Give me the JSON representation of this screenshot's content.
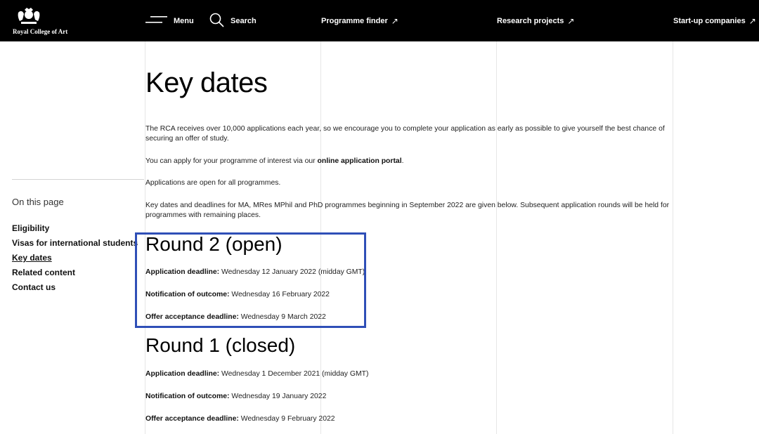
{
  "header": {
    "logo_text": "Royal College of Art",
    "menu_label": "Menu",
    "search_label": "Search",
    "programme_finder": "Programme finder",
    "research_projects": "Research projects",
    "startups": "Start-up companies",
    "external_arrow": "↗"
  },
  "sidebar": {
    "heading": "On this page",
    "items": [
      {
        "label": "Eligibility"
      },
      {
        "label": "Visas for international students"
      },
      {
        "label": "Key dates"
      },
      {
        "label": "Related content"
      },
      {
        "label": "Contact us"
      }
    ]
  },
  "main": {
    "title": "Key dates",
    "intro": "The RCA receives over 10,000 applications each year, so we encourage you to complete your application as early as possible to give yourself the best chance of securing an offer of study.",
    "apply_prefix": "You can apply for your programme of interest via our ",
    "apply_link": "online application portal",
    "apply_suffix": ".",
    "open_note": "Applications are open for all programmes.",
    "deadlines_note": "Key dates and deadlines for MA, MRes MPhil and PhD programmes beginning in September 2022 are given below. Subsequent application rounds will be held for programmes with remaining places.",
    "rounds": [
      {
        "title": "Round 2 (open)",
        "rows": [
          {
            "label": "Application deadline:",
            "value": " Wednesday 12 January 2022 (midday GMT)"
          },
          {
            "label": "Notification of outcome:",
            "value": " Wednesday 16 February 2022"
          },
          {
            "label": "Offer acceptance deadline:",
            "value": " Wednesday 9 March 2022"
          }
        ]
      },
      {
        "title": "Round 1 (closed)",
        "rows": [
          {
            "label": "Application deadline:",
            "value": " Wednesday 1 December 2021 (midday GMT)"
          },
          {
            "label": "Notification of outcome:",
            "value": " Wednesday 19 January 2022"
          },
          {
            "label": "Offer acceptance deadline:",
            "value": " Wednesday 9 February 2022"
          }
        ]
      }
    ]
  },
  "colors": {
    "header_bg": "#000000",
    "highlight_border": "#2f4fb7",
    "text": "#111111"
  }
}
